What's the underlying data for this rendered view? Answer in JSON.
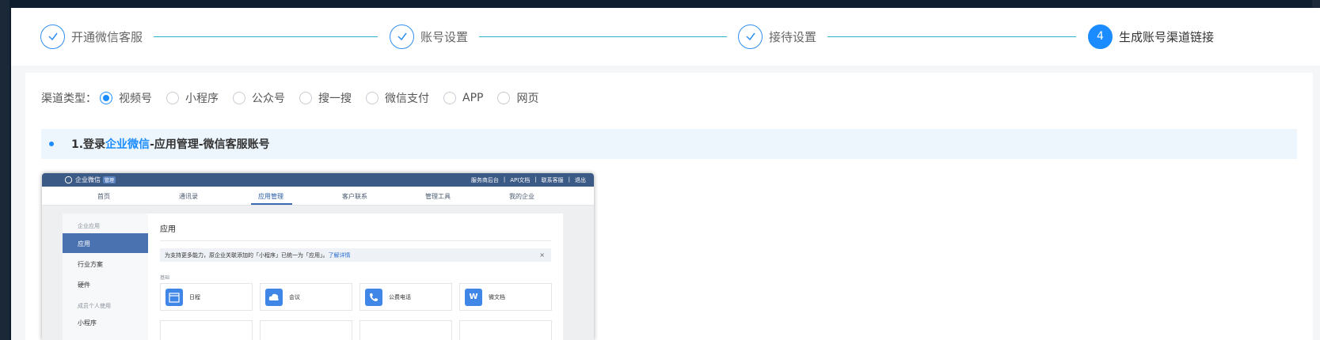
{
  "steps": [
    {
      "label": "开通微信客服",
      "state": "done",
      "icon": "check-icon"
    },
    {
      "label": "账号设置",
      "state": "done",
      "icon": "check-icon"
    },
    {
      "label": "接待设置",
      "state": "done",
      "icon": "check-icon"
    },
    {
      "number": "4",
      "label": "生成账号渠道链接",
      "state": "active"
    }
  ],
  "channel": {
    "title": "渠道类型：",
    "selected": "视频号",
    "options": [
      "视频号",
      "小程序",
      "公众号",
      "搜一搜",
      "微信支付",
      "APP",
      "网页"
    ]
  },
  "instruction": {
    "prefix": "1.登录",
    "highlight": "企业微信",
    "suffix": "-应用管理-微信客服账号"
  },
  "screenshot": {
    "logo_text": "企业微信",
    "logo_tag": "管理",
    "top_links": [
      "服务商后台",
      "|",
      "API文档",
      "|",
      "联系客服",
      "|",
      "退出"
    ],
    "nav": [
      "首页",
      "通讯录",
      "应用管理",
      "客户联系",
      "管理工具",
      "我的企业"
    ],
    "active_nav": "应用管理",
    "sidebar": {
      "section1": "企业应用",
      "item_active": "应用",
      "item2": "行业方案",
      "item3": "硬件",
      "section2": "成员个人使用",
      "item4": "小程序"
    },
    "main_title": "应用",
    "notice": {
      "text": "为支持更多能力，原企业关联添加的「小程序」已统一为「应用」。",
      "link": "了解详情",
      "close": "×"
    },
    "section_label": "基础",
    "apps": [
      {
        "name": "日程",
        "icon": "calendar-icon"
      },
      {
        "name": "会议",
        "icon": "cloud-icon"
      },
      {
        "name": "公费电话",
        "icon": "phone-icon"
      },
      {
        "name": "微文档",
        "icon": "doc-w-icon",
        "glyph": "W"
      }
    ]
  },
  "colors": {
    "accent": "#1a8cff",
    "step_line": "#2bb3c8",
    "header_blue": "#3c5a86"
  }
}
